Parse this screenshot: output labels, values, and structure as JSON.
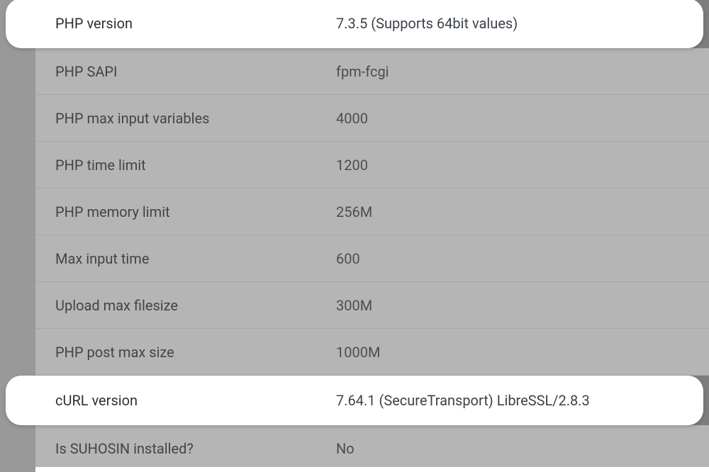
{
  "rows": [
    {
      "label": "PHP version",
      "value": "7.3.5 (Supports 64bit values)",
      "highlighted": true
    },
    {
      "label": "PHP SAPI",
      "value": "fpm-fcgi",
      "highlighted": false
    },
    {
      "label": "PHP max input variables",
      "value": "4000",
      "highlighted": false
    },
    {
      "label": "PHP time limit",
      "value": "1200",
      "highlighted": false
    },
    {
      "label": "PHP memory limit",
      "value": "256M",
      "highlighted": false
    },
    {
      "label": "Max input time",
      "value": "600",
      "highlighted": false
    },
    {
      "label": "Upload max filesize",
      "value": "300M",
      "highlighted": false
    },
    {
      "label": "PHP post max size",
      "value": "1000M",
      "highlighted": false
    },
    {
      "label": "cURL version",
      "value": "7.64.1 (SecureTransport) LibreSSL/2.8.3",
      "highlighted": true
    },
    {
      "label": "Is SUHOSIN installed?",
      "value": "No",
      "highlighted": false
    }
  ]
}
